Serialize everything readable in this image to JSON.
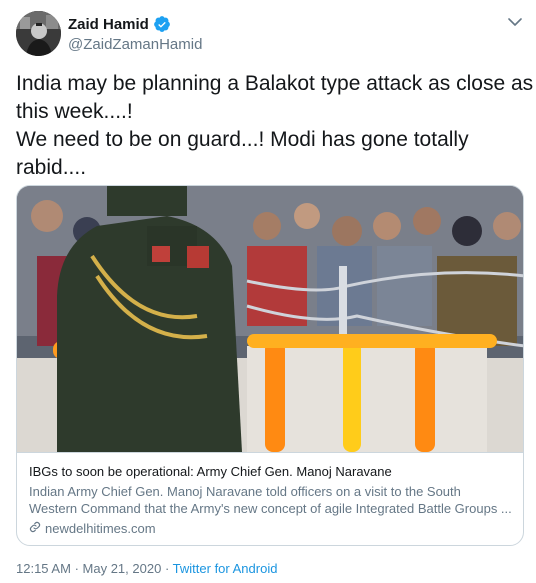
{
  "author": {
    "name": "Zaid Hamid",
    "handle": "@ZaidZamanHamid",
    "verified": true
  },
  "tweet": {
    "lines": [
      "India may be planning a Balakot type attack as close as",
      "this week....!",
      "We need to be on guard...! Modi has gone totally",
      "rabid...."
    ]
  },
  "card": {
    "title": "IBGs to soon be operational: Army Chief Gen. Manoj Naravane",
    "description_lines": [
      "Indian Army Chief Gen. Manoj Naravane told officers on a visit to the South",
      "Western Command that the Army's new concept of agile Integrated Battle Groups ..."
    ],
    "domain": "newdelhitimes.com"
  },
  "meta": {
    "time": "12:15 AM",
    "separator": "·",
    "date": "May 21, 2020",
    "source": "Twitter for Android"
  },
  "colors": {
    "text": "#14171a",
    "secondary": "#657786",
    "link": "#1b95e0",
    "border": "#ccd6dd",
    "verified": "#1da1f2"
  },
  "icons": [
    "verified-badge-icon",
    "chevron-down-icon",
    "link-icon"
  ]
}
